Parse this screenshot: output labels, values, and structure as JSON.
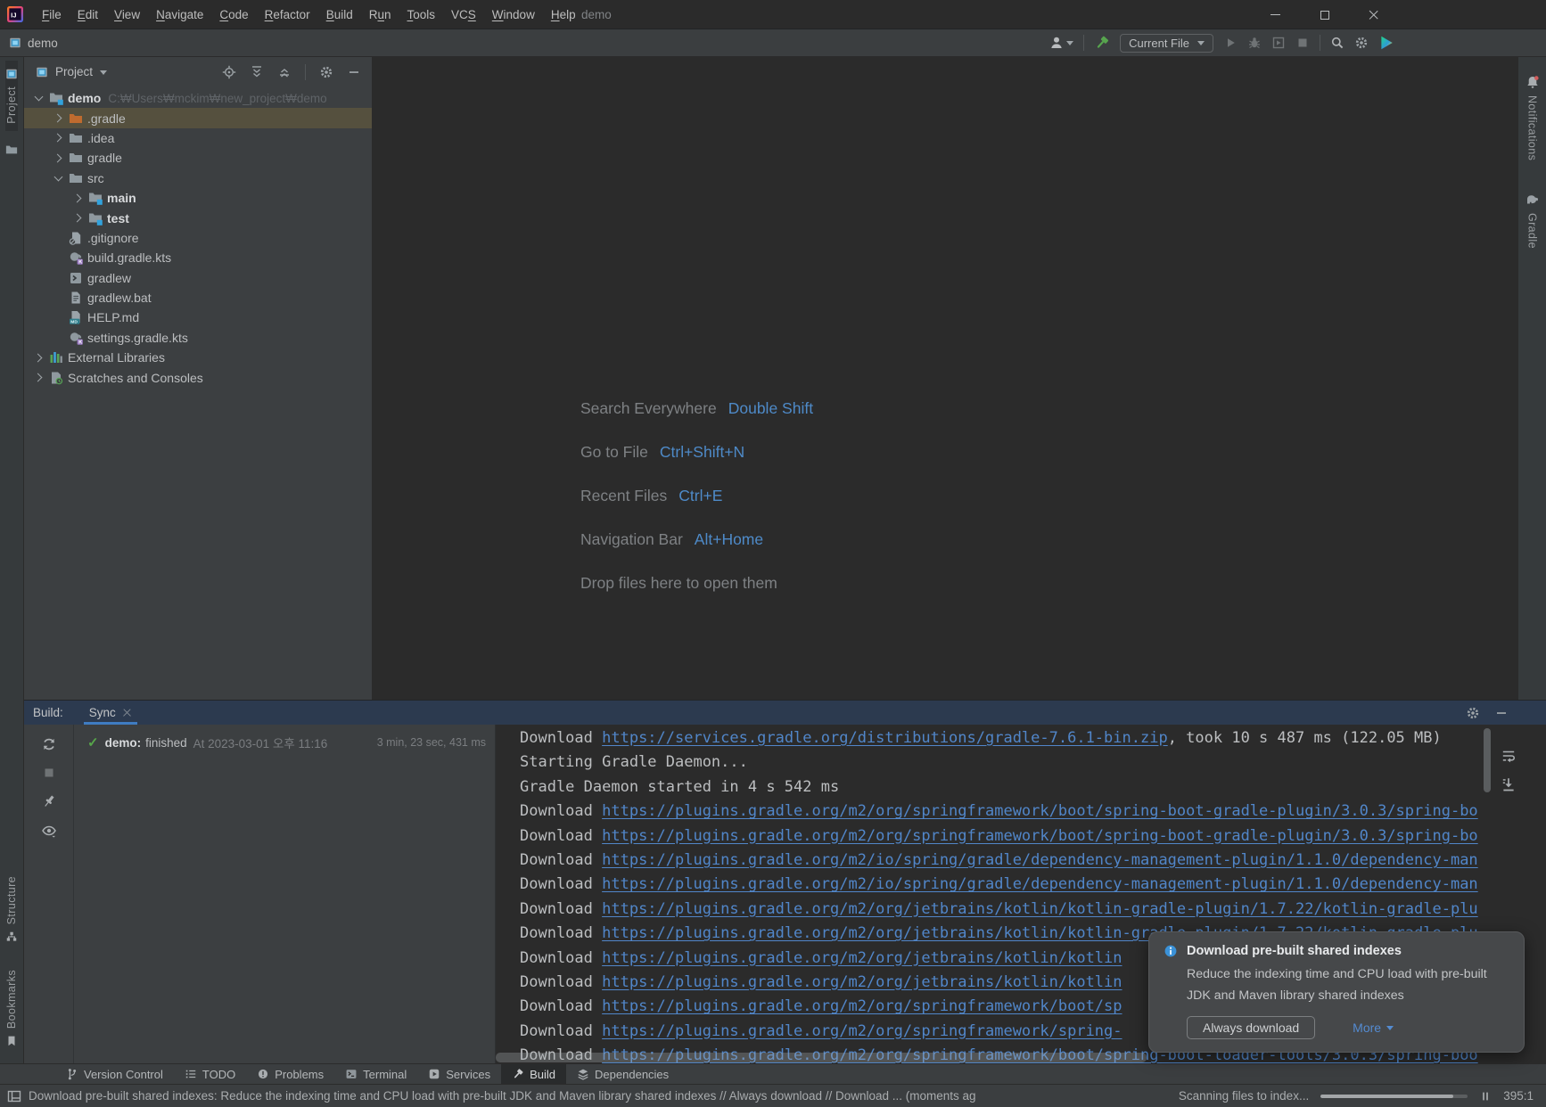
{
  "colors": {
    "accent_blue": "#3f7cc2",
    "link_blue": "#5186c9",
    "success_green": "#57a64a",
    "selected_row_olive": "#55503e",
    "notification_info_blue": "#3b92d8",
    "build_header_bg": "#2c3a4f"
  },
  "title_bar": {
    "title": "demo",
    "menus": [
      {
        "label": "File",
        "mnemonic_index": 0
      },
      {
        "label": "Edit",
        "mnemonic_index": 0
      },
      {
        "label": "View",
        "mnemonic_index": 0
      },
      {
        "label": "Navigate",
        "mnemonic_index": 0
      },
      {
        "label": "Code",
        "mnemonic_index": 0
      },
      {
        "label": "Refactor",
        "mnemonic_index": 0
      },
      {
        "label": "Build",
        "mnemonic_index": 0
      },
      {
        "label": "Run",
        "mnemonic_index": 1
      },
      {
        "label": "Tools",
        "mnemonic_index": 0
      },
      {
        "label": "VCS",
        "mnemonic_index": 2
      },
      {
        "label": "Window",
        "mnemonic_index": 0
      },
      {
        "label": "Help",
        "mnemonic_index": 0
      }
    ]
  },
  "toolbar": {
    "project_breadcrumb": "demo",
    "run_config_selector": "Current File"
  },
  "left_stripe": {
    "project_tab": "Project",
    "structure_tab": "Structure",
    "bookmarks_tab": "Bookmarks"
  },
  "right_stripe": {
    "notifications_tab": "Notifications",
    "gradle_tab": "Gradle"
  },
  "project_panel": {
    "header_title": "Project",
    "tree": [
      {
        "label": "demo",
        "path": "C:₩Users₩mckim₩new_project₩demo",
        "icon": "folder-project",
        "level": 0,
        "chevron": "expanded",
        "bold": true
      },
      {
        "label": ".gradle",
        "icon": "folder-excluded",
        "level": 1,
        "chevron": "collapsed",
        "selected": true
      },
      {
        "label": ".idea",
        "icon": "folder",
        "level": 1,
        "chevron": "collapsed"
      },
      {
        "label": "gradle",
        "icon": "folder",
        "level": 1,
        "chevron": "collapsed"
      },
      {
        "label": "src",
        "icon": "folder",
        "level": 1,
        "chevron": "expanded"
      },
      {
        "label": "main",
        "icon": "folder-source",
        "level": 2,
        "chevron": "collapsed",
        "bold": true
      },
      {
        "label": "test",
        "icon": "folder-source",
        "level": 2,
        "chevron": "collapsed",
        "bold": true
      },
      {
        "label": ".gitignore",
        "icon": "file-ignore",
        "level": 1,
        "chevron": "none"
      },
      {
        "label": "build.gradle.kts",
        "icon": "file-gradle",
        "level": 1,
        "chevron": "none"
      },
      {
        "label": "gradlew",
        "icon": "file-executable",
        "level": 1,
        "chevron": "none"
      },
      {
        "label": "gradlew.bat",
        "icon": "file-text",
        "level": 1,
        "chevron": "none"
      },
      {
        "label": "HELP.md",
        "icon": "file-markdown",
        "level": 1,
        "chevron": "none"
      },
      {
        "label": "settings.gradle.kts",
        "icon": "file-gradle",
        "level": 1,
        "chevron": "none"
      },
      {
        "label": "External Libraries",
        "icon": "library",
        "level": 0,
        "chevron": "collapsed"
      },
      {
        "label": "Scratches and Consoles",
        "icon": "scratches",
        "level": 0,
        "chevron": "collapsed"
      }
    ]
  },
  "editor": {
    "shortcut_hints": [
      {
        "action": "Search Everywhere",
        "keys": "Double Shift"
      },
      {
        "action": "Go to File",
        "keys": "Ctrl+Shift+N"
      },
      {
        "action": "Recent Files",
        "keys": "Ctrl+E"
      },
      {
        "action": "Navigation Bar",
        "keys": "Alt+Home"
      },
      {
        "action": "Drop files here to open them",
        "keys": ""
      }
    ]
  },
  "build_panel": {
    "panel_label": "Build:",
    "tab_label": "Sync",
    "run_summary": {
      "target": "demo:",
      "status": "finished",
      "timestamp": "At 2023-03-01 오후 11:16",
      "duration": "3 min, 23 sec, 431 ms"
    },
    "console": [
      {
        "pre": "Download ",
        "link": "https://services.gradle.org/distributions/gradle-7.6.1-bin.zip",
        "post": ", took 10 s 487 ms (122.05 MB)"
      },
      {
        "pre": "Starting Gradle Daemon...",
        "link": "",
        "post": ""
      },
      {
        "pre": "Gradle Daemon started in 4 s 542 ms",
        "link": "",
        "post": ""
      },
      {
        "pre": "Download ",
        "link": "https://plugins.gradle.org/m2/org/springframework/boot/spring-boot-gradle-plugin/3.0.3/spring-bo",
        "post": ""
      },
      {
        "pre": "Download ",
        "link": "https://plugins.gradle.org/m2/org/springframework/boot/spring-boot-gradle-plugin/3.0.3/spring-bo",
        "post": ""
      },
      {
        "pre": "Download ",
        "link": "https://plugins.gradle.org/m2/io/spring/gradle/dependency-management-plugin/1.1.0/dependency-man",
        "post": ""
      },
      {
        "pre": "Download ",
        "link": "https://plugins.gradle.org/m2/io/spring/gradle/dependency-management-plugin/1.1.0/dependency-man",
        "post": ""
      },
      {
        "pre": "Download ",
        "link": "https://plugins.gradle.org/m2/org/jetbrains/kotlin/kotlin-gradle-plugin/1.7.22/kotlin-gradle-plu",
        "post": ""
      },
      {
        "pre": "Download ",
        "link": "https://plugins.gradle.org/m2/org/jetbrains/kotlin/kotlin-gradle-plugin/1.7.22/kotlin-gradle-plu",
        "post": ""
      },
      {
        "pre": "Download ",
        "link": "https://plugins.gradle.org/m2/org/jetbrains/kotlin/kotlin",
        "post": ""
      },
      {
        "pre": "Download ",
        "link": "https://plugins.gradle.org/m2/org/jetbrains/kotlin/kotlin",
        "post": ""
      },
      {
        "pre": "Download ",
        "link": "https://plugins.gradle.org/m2/org/springframework/boot/sp",
        "post": ""
      },
      {
        "pre": "Download ",
        "link": "https://plugins.gradle.org/m2/org/springframework/spring-",
        "post": ""
      },
      {
        "pre": "Download ",
        "link": "https://plugins.gradle.org/m2/org/springframework/boot/spring-boot-loader-tools/3.0.3/spring-boo",
        "post": ""
      }
    ]
  },
  "notification": {
    "title": "Download pre-built shared indexes",
    "body": "Reduce the indexing time and CPU load with pre-built JDK and Maven library shared indexes",
    "primary_button": "Always download",
    "more_button": "More"
  },
  "bottom_bar": {
    "tools": [
      {
        "label": "Version Control",
        "icon": "branch"
      },
      {
        "label": "TODO",
        "icon": "todo"
      },
      {
        "label": "Problems",
        "icon": "problems"
      },
      {
        "label": "Terminal",
        "icon": "terminal"
      },
      {
        "label": "Services",
        "icon": "services"
      },
      {
        "label": "Build",
        "icon": "hammer-small",
        "active": true
      },
      {
        "label": "Dependencies",
        "icon": "dependencies"
      }
    ]
  },
  "status_bar": {
    "message": "Download pre-built shared indexes: Reduce the indexing time and CPU load with pre-built JDK and Maven library shared indexes // Always download // Download ... (moments ag",
    "indexing_label": "Scanning files to index...",
    "caret_position": "395:1",
    "progress_percent": 90
  }
}
